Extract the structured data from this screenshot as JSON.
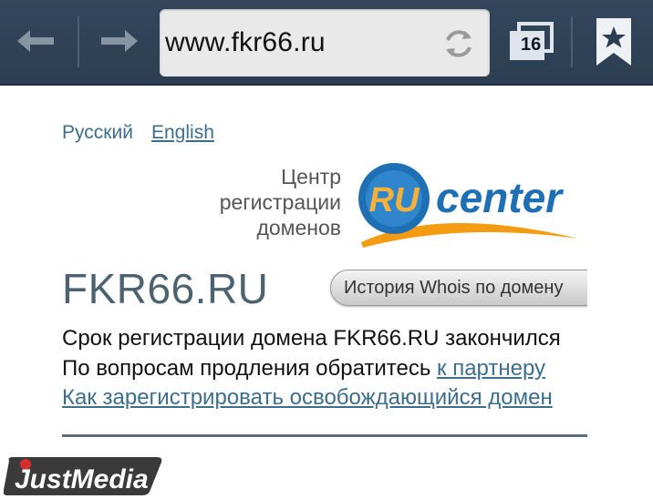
{
  "browser": {
    "url": "www.fkr66.ru",
    "tab_count": "16",
    "icons": {
      "back": "back-arrow-icon",
      "forward": "forward-arrow-icon",
      "reload": "reload-icon",
      "tabs": "tabs-icon",
      "bookmark": "bookmark-star-icon"
    }
  },
  "page": {
    "languages": [
      "Русский",
      "English"
    ],
    "center_text": [
      "Центр",
      "регистрации",
      "доменов"
    ],
    "logo": {
      "part1": "RU",
      "part2": "center"
    },
    "domain": "FKR66.RU",
    "whois_button": "История Whois по домену",
    "line1": "Срок регистрации домена FKR66.RU закончился",
    "line2_prefix": "По вопросам продления обратитесь ",
    "line2_link": "к партнеру",
    "line3_link": "Как зарегистрировать освобождающийся домен"
  },
  "watermark": {
    "text": "JustMedia"
  },
  "colors": {
    "toolbar": "#33465b",
    "link": "#3c6e8c",
    "title": "#4d6270",
    "logo_blue": "#1f6fb4",
    "logo_orange": "#f39c12"
  }
}
